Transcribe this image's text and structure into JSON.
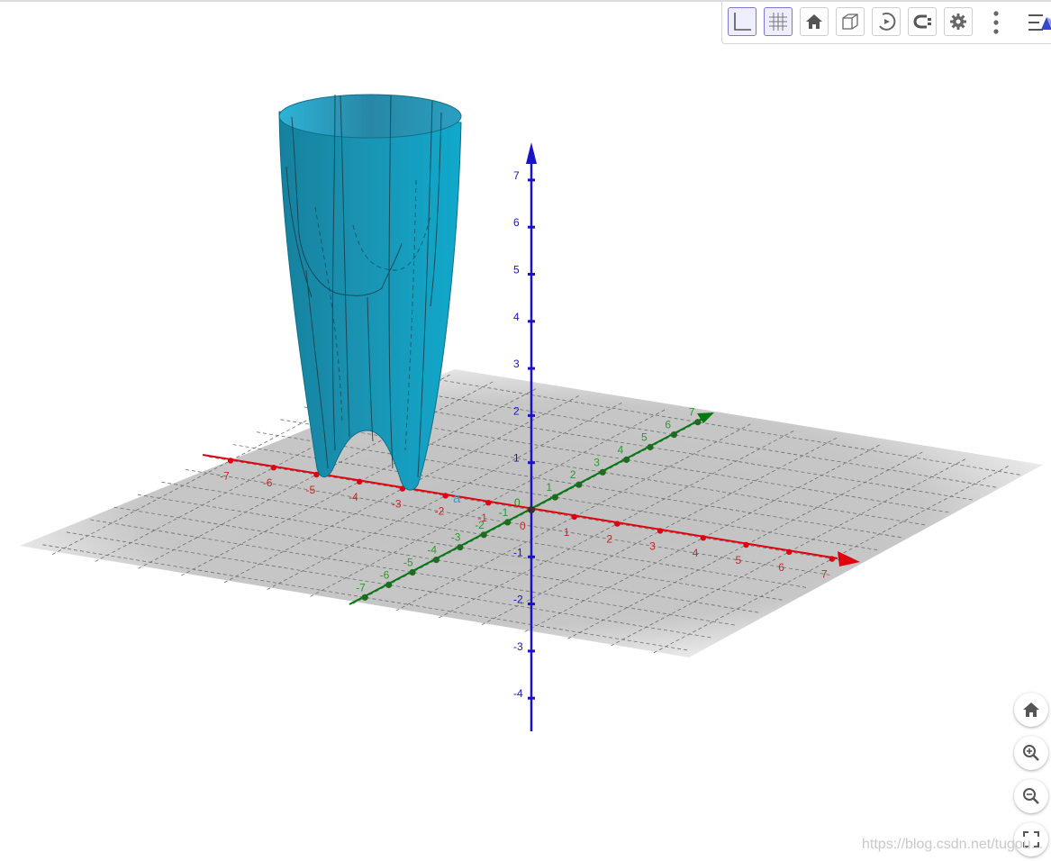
{
  "toolbar": {
    "buttons": [
      {
        "name": "axes-toggle-button",
        "icon": "axes-icon",
        "active": true
      },
      {
        "name": "grid-toggle-button",
        "icon": "grid-icon",
        "active": true
      },
      {
        "name": "standard-view-button",
        "icon": "home-icon",
        "active": false
      },
      {
        "name": "view-in-front-button",
        "icon": "cube-icon",
        "active": false
      },
      {
        "name": "rotate-view-button",
        "icon": "rotate-icon",
        "active": false
      },
      {
        "name": "projection-button",
        "icon": "projection-icon",
        "active": false
      },
      {
        "name": "settings-button",
        "icon": "gear-icon",
        "active": false
      }
    ]
  },
  "scene": {
    "axis_colors": {
      "x": "#e0000e",
      "y": "#007a10",
      "z": "#1a12c8"
    },
    "x_ticks": [
      "-7",
      "-6",
      "-5",
      "-4",
      "-3",
      "-2",
      "-1",
      "1",
      "2",
      "3",
      "4",
      "5",
      "6",
      "7"
    ],
    "y_ticks": [
      "-7",
      "-6",
      "-5",
      "-4",
      "-3",
      "-2",
      "-1",
      "1",
      "2",
      "3",
      "4",
      "5",
      "6",
      "7"
    ],
    "z_ticks": [
      "7",
      "6",
      "5",
      "4",
      "3",
      "2",
      "1",
      "-1",
      "-2",
      "-3",
      "-4"
    ],
    "origin_label": "0",
    "surface_label": "a",
    "surface_color": "#20a4c4"
  },
  "watermark": "https://blog.csdn.net/tugou..."
}
